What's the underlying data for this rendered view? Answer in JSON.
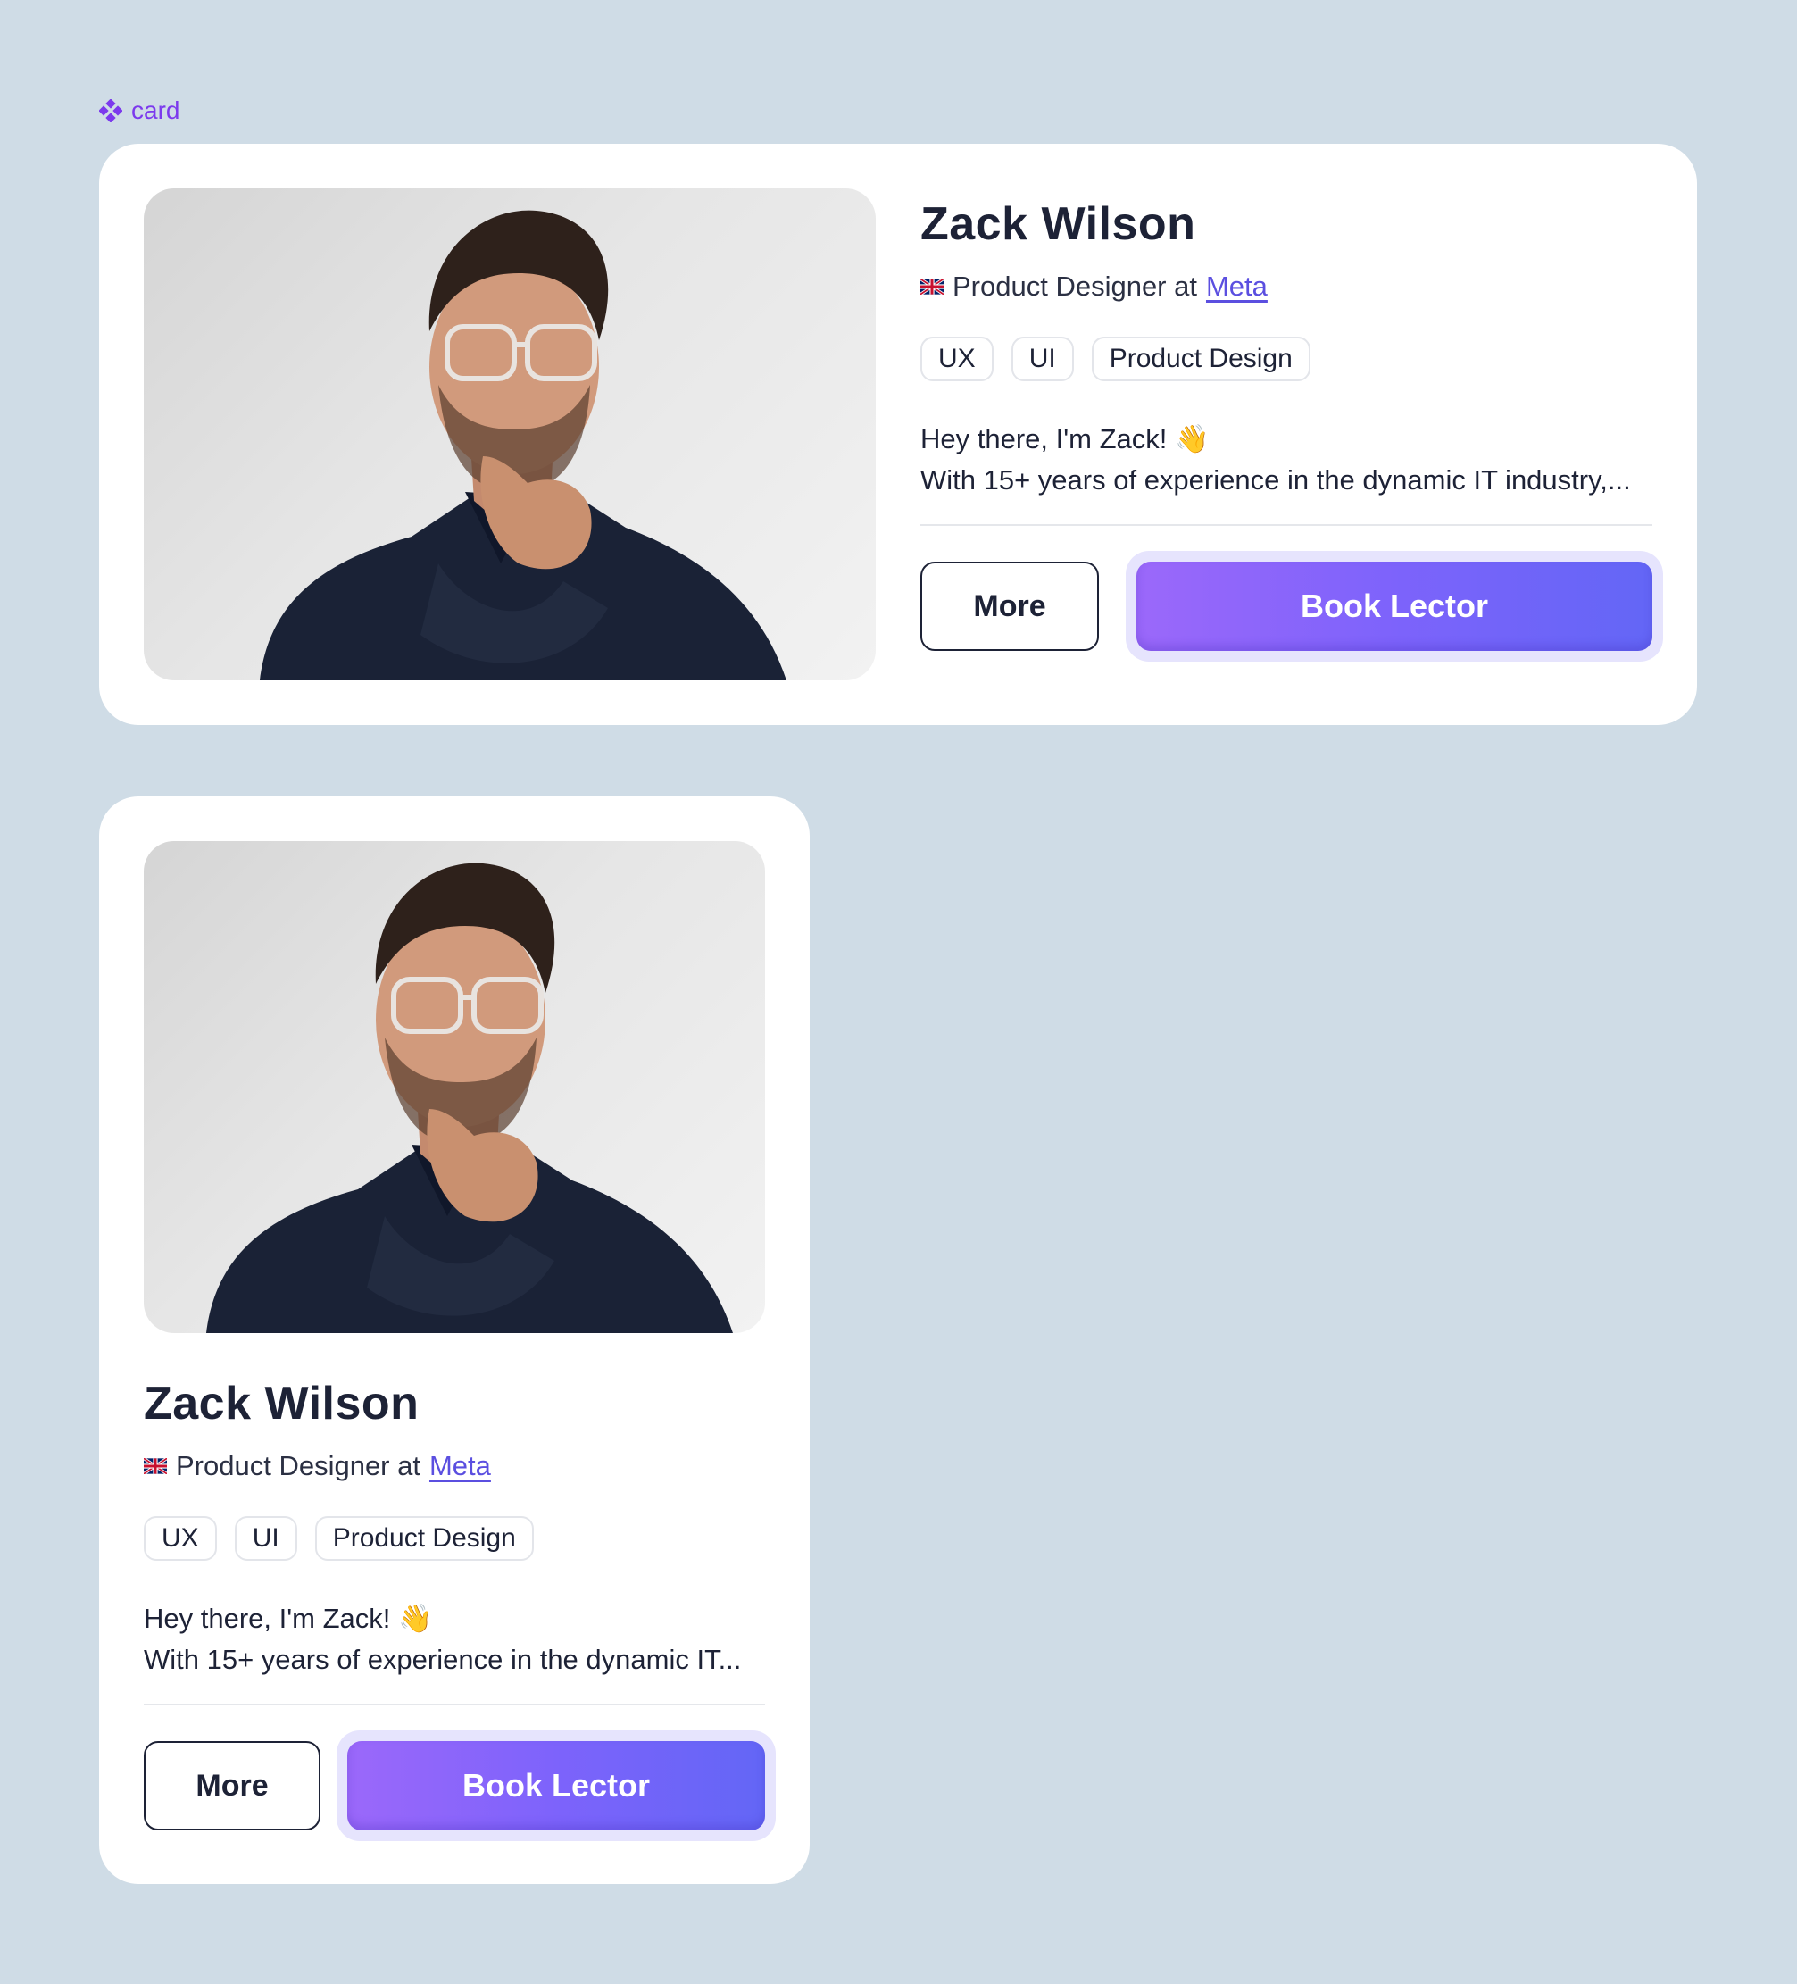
{
  "component_label": "card",
  "cards": [
    {
      "name": "Zack Wilson",
      "role_prefix": "Product Designer at",
      "company": "Meta",
      "tags": [
        "UX",
        "UI",
        "Product Design"
      ],
      "bio_line1": "Hey there, I'm Zack! 👋",
      "bio_line2": "With 15+ years of experience in the dynamic IT industry,...",
      "more_label": "More",
      "book_label": "Book Lector"
    },
    {
      "name": "Zack Wilson",
      "role_prefix": "Product Designer at",
      "company": "Meta",
      "tags": [
        "UX",
        "UI",
        "Product Design"
      ],
      "bio_line1": "Hey there, I'm Zack! 👋",
      "bio_line2": "With 15+ years of experience in the dynamic IT...",
      "more_label": "More",
      "book_label": "Book Lector"
    }
  ],
  "colors": {
    "background": "#cfdce6",
    "accent": "#7c3aed",
    "link": "#5b4fe0",
    "button_gradient_start": "#9b68fa",
    "button_gradient_end": "#6366f6"
  },
  "icons": {
    "component": "component-icon",
    "flag": "uk-flag-icon"
  }
}
